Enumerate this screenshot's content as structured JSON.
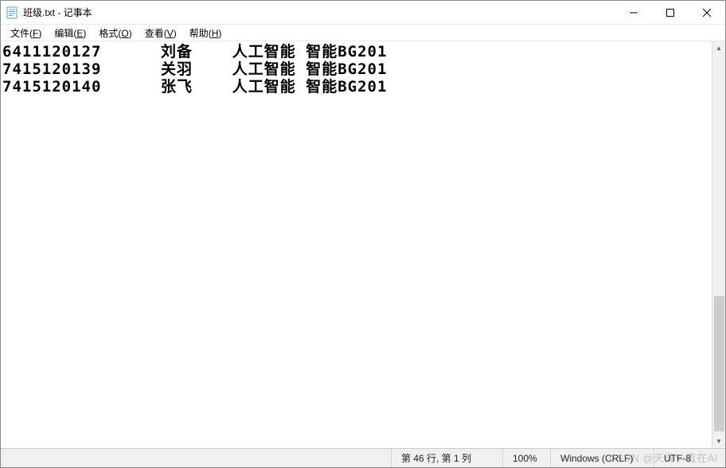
{
  "window": {
    "title": "班级.txt - 记事本"
  },
  "menu": {
    "file": "文件(F)",
    "edit": "编辑(E)",
    "format": "格式(O)",
    "view": "查看(V)",
    "help": "帮助(H)"
  },
  "content": {
    "lines": [
      "6411120127      刘备    人工智能 智能BG201",
      "7415120139      关羽    人工智能 智能BG201",
      "7415120140      张飞    人工智能 智能BG201"
    ]
  },
  "status": {
    "position": "第 46 行, 第 1 列",
    "zoom": "100%",
    "lineending": "Windows (CRLF)",
    "encoding": "UTF-8"
  },
  "watermark": "CSDN @天海一直在AI"
}
